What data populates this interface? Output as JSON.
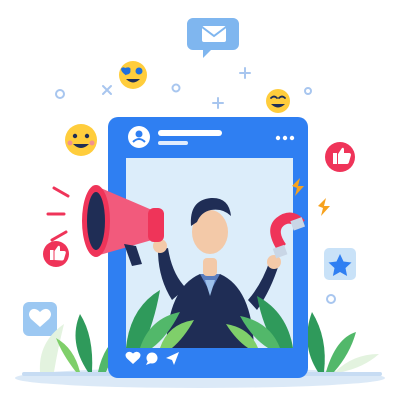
{
  "illustration": {
    "subject": "social-media-marketing",
    "colors": {
      "post_frame": "#2f7ff2",
      "post_inner": "#cfe6f8",
      "dark_navy": "#1f2d55",
      "accent_red": "#ef3459",
      "accent_pink": "#f25a7c",
      "light_blue_card": "#c9e2f8",
      "emoji_yellow": "#ffcd3c",
      "leaf_green": "#2f9a5b",
      "leaf_light": "#7fcf6a",
      "lightning": "#f7a21e",
      "skin": "#f3c9a8",
      "shirt": "#5a7dbf"
    },
    "icons": [
      "mail-icon",
      "heart-eyes-emoji-icon",
      "laughing-emoji-icon",
      "smiley-emoji-icon",
      "thumbs-up-icon",
      "heart-icon",
      "star-icon",
      "megaphone-icon",
      "magnet-icon",
      "lightning-icon",
      "like-heart-icon",
      "comment-icon",
      "share-icon"
    ]
  }
}
